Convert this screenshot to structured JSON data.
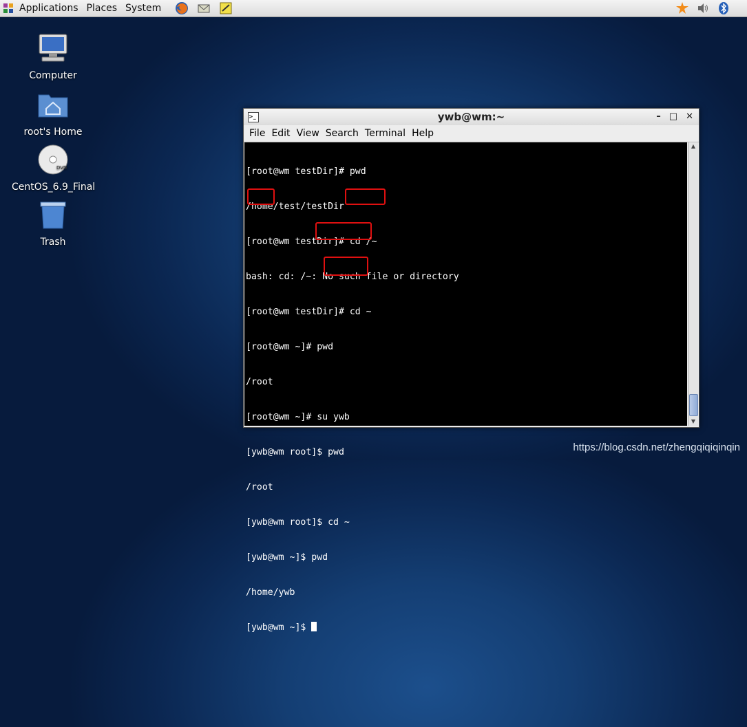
{
  "panel": {
    "menus": [
      "Applications",
      "Places",
      "System"
    ],
    "launchers": [
      "firefox-icon",
      "mail-icon",
      "notes-icon"
    ],
    "tray": [
      "update-icon",
      "volume-icon",
      "bluetooth-icon"
    ]
  },
  "desktop": {
    "icons": [
      {
        "label": "Computer",
        "icon": "computer-icon"
      },
      {
        "label": "root's Home",
        "icon": "home-folder-icon"
      },
      {
        "label": "CentOS_6.9_Final",
        "icon": "dvd-icon"
      },
      {
        "label": "Trash",
        "icon": "trash-icon"
      }
    ]
  },
  "terminal": {
    "title": "ywb@wm:~",
    "buttons": {
      "minimize": "–",
      "maximize": "□",
      "close": "✕"
    },
    "menu": [
      "File",
      "Edit",
      "View",
      "Search",
      "Terminal",
      "Help"
    ],
    "lines": [
      "[root@wm testDir]# pwd",
      "/home/test/testDir",
      "[root@wm testDir]# cd /~",
      "bash: cd: /~: No such file or directory",
      "[root@wm testDir]# cd ~",
      "[root@wm ~]# pwd",
      "/root",
      "[root@wm ~]# su ywb",
      "[ywb@wm root]$ pwd",
      "/root",
      "[ywb@wm root]$ cd ~",
      "[ywb@wm ~]$ pwd",
      "/home/ywb",
      "[ywb@wm ~]$ "
    ]
  },
  "highlight_color": "#e01010",
  "watermark": "https://blog.csdn.net/zhengqiqiqinqin"
}
